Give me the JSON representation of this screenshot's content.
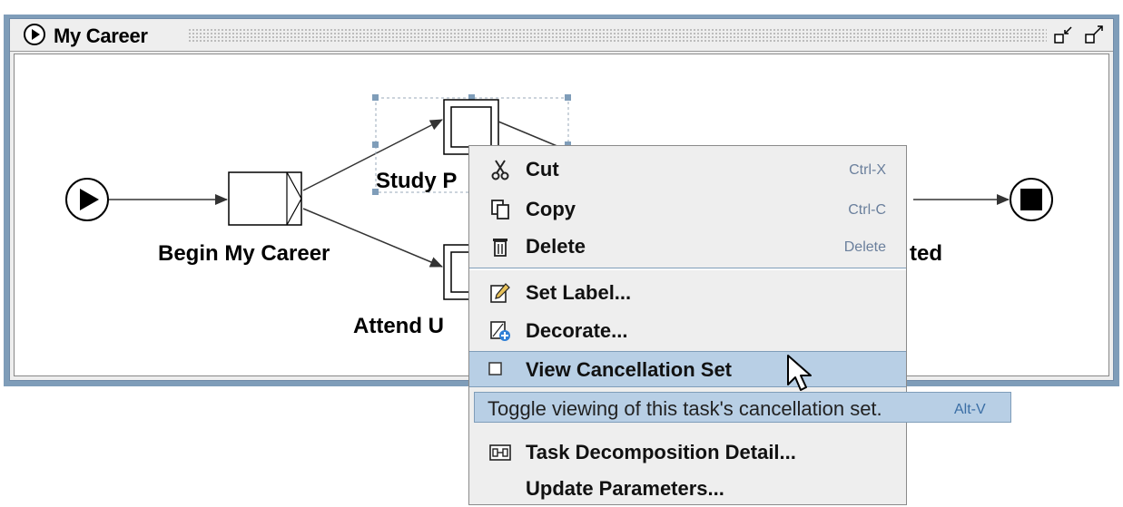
{
  "window": {
    "title": "My Career"
  },
  "diagram": {
    "labels": {
      "begin": "Begin My Career",
      "study": "Study P",
      "attend": "Attend U",
      "end_fragment": "ted"
    }
  },
  "context_menu": {
    "items": [
      {
        "label": "Cut",
        "shortcut": "Ctrl-X",
        "icon": "scissors-icon"
      },
      {
        "label": "Copy",
        "shortcut": "Ctrl-C",
        "icon": "copy-icon"
      },
      {
        "label": "Delete",
        "shortcut": "Delete",
        "icon": "trash-icon"
      },
      {
        "label": "Set Label...",
        "shortcut": "",
        "icon": "pencil-icon"
      },
      {
        "label": "Decorate...",
        "shortcut": "",
        "icon": "decorate-icon"
      },
      {
        "label": "View Cancellation Set",
        "shortcut": "",
        "icon": "checkbox-icon"
      },
      {
        "label": "Task Decomposition Detail...",
        "shortcut": "",
        "icon": "decomposition-icon"
      },
      {
        "label": "Update Parameters...",
        "shortcut": "",
        "icon": ""
      }
    ]
  },
  "tooltip": {
    "text": "Toggle viewing of this task's cancellation set.",
    "accelerator": "Alt-V"
  },
  "colors": {
    "selection": "#b8cfe5",
    "border": "#7f9db9",
    "accelerator": "#6a7f9c"
  }
}
